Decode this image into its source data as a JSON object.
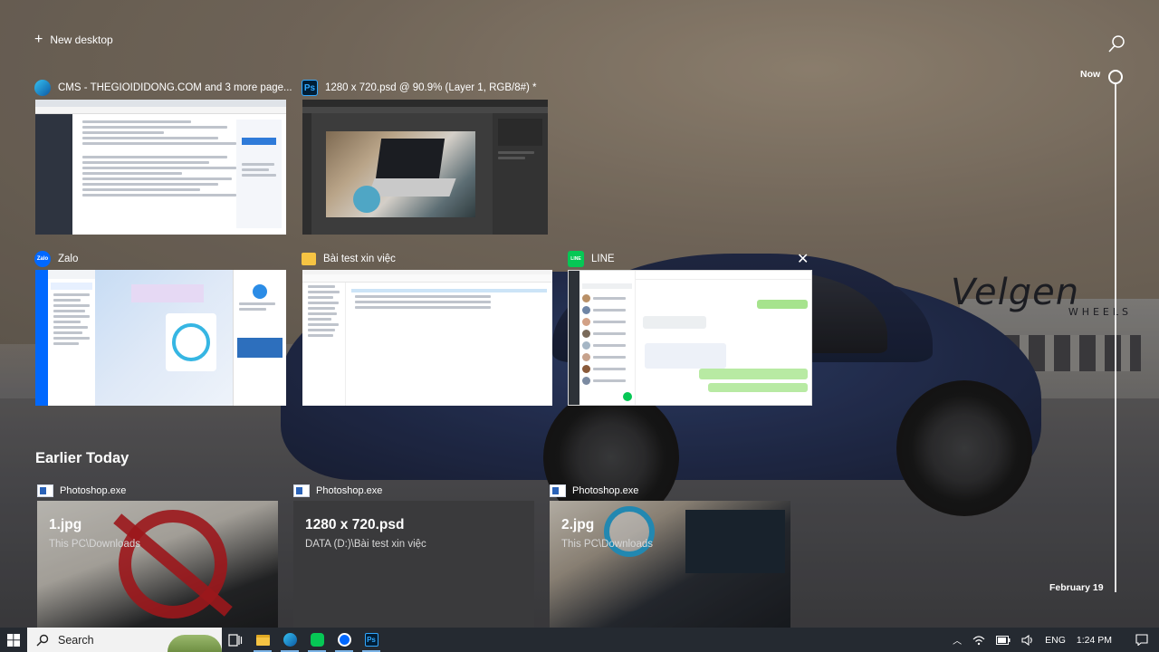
{
  "top": {
    "new_desktop_label": "New desktop"
  },
  "windows": [
    {
      "title": "CMS - THEGIOIDIDONG.COM and 3 more page...",
      "icon": "edge-icon"
    },
    {
      "title": "1280 x 720.psd @ 90.9% (Layer 1, RGB/8#) *",
      "icon": "photoshop-icon",
      "icon_text": "Ps"
    },
    {
      "title": "Zalo",
      "icon": "zalo-icon",
      "icon_text": "Zalo"
    },
    {
      "title": "Bài test xin việc",
      "icon": "folder-icon"
    },
    {
      "title": "LINE",
      "icon": "line-icon",
      "icon_text": "LINE"
    }
  ],
  "timeline": {
    "section_title": "Earlier Today",
    "now_label": "Now",
    "date_label": "February 19",
    "activities": [
      {
        "app": "Photoshop.exe",
        "title": "1.jpg",
        "path": "This PC\\Downloads"
      },
      {
        "app": "Photoshop.exe",
        "title": "1280 x 720.psd",
        "path": "DATA (D:)\\Bài test xin việc"
      },
      {
        "app": "Photoshop.exe",
        "title": "2.jpg",
        "path": "This PC\\Downloads"
      }
    ]
  },
  "taskbar": {
    "search_label": "Search",
    "language": "ENG",
    "time": "1:24 PM",
    "pinned": [
      "task-view-icon",
      "file-explorer-icon",
      "edge-icon",
      "line-icon",
      "zalo-icon",
      "photoshop-icon"
    ]
  },
  "wallpaper": {
    "brand_text": "Velgen",
    "brand_sub": "WHEELS"
  },
  "colors": {
    "taskbar_bg": "#252a31",
    "photoshop_blue": "#31a8ff",
    "line_green": "#06c755",
    "zalo_blue": "#0068ff"
  }
}
